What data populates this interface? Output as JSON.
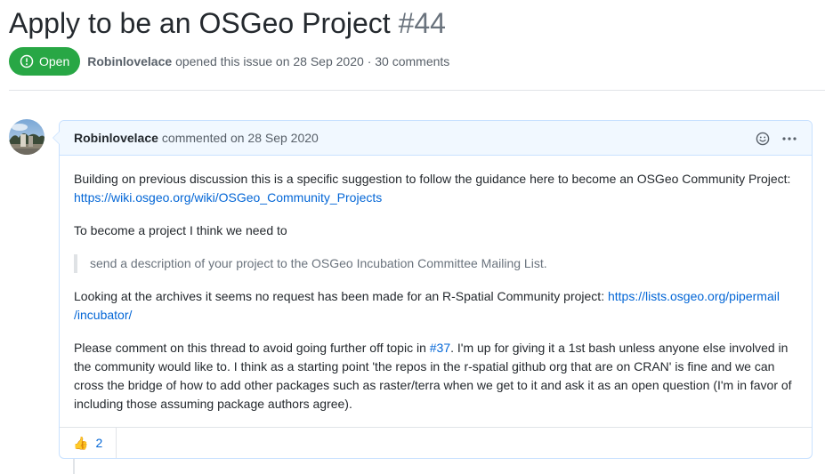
{
  "issue": {
    "title": "Apply to be an OSGeo Project",
    "number": "#44",
    "state": "Open",
    "author": "Robinlovelace",
    "opened_text": "opened this issue on 28 Sep 2020",
    "separator": "·",
    "comments_count": "30 comments"
  },
  "comment": {
    "author": "Robinlovelace",
    "action": "commented on 28 Sep 2020",
    "icons": [
      "smiley-icon",
      "kebab-horizontal-icon"
    ],
    "body": {
      "p1_text": "Building on previous discussion this is a specific suggestion to follow the guidance here to become an OSGeo Community Project:",
      "p1_link": "https://wiki.osgeo.org/wiki/OSGeo_Community_Projects",
      "p2_text": "To become a project I think we need to",
      "quote": "send a description of your project to the OSGeo Incubation Committee Mailing List.",
      "p3_text": "Looking at the archives it seems no request has been made for an R-Spatial Community project:",
      "p3_link_line1": "https://lists.osgeo.org/pipermail",
      "p3_link_line2": "/incubator/",
      "p4_before": "Please comment on this thread to avoid going further off topic in",
      "p4_link": "#37",
      "p4_after": ". I'm up for giving it a 1st bash unless anyone else involved in the community would like to. I think as a starting point 'the repos in the r-spatial github org that are on CRAN' is fine and we can cross the bridge of how to add other packages such as raster/terra when we get to it and ask it as an open question (I'm in favor of including those assuming package authors agree)."
    },
    "reactions": [
      {
        "emoji": "👍",
        "icon": "thumbs-up-icon",
        "count": "2"
      }
    ]
  },
  "colors": {
    "open_green": "#28a745",
    "link_blue": "#0366d6",
    "header_bg": "#f1f8ff",
    "border_blue": "#c8e1ff"
  }
}
